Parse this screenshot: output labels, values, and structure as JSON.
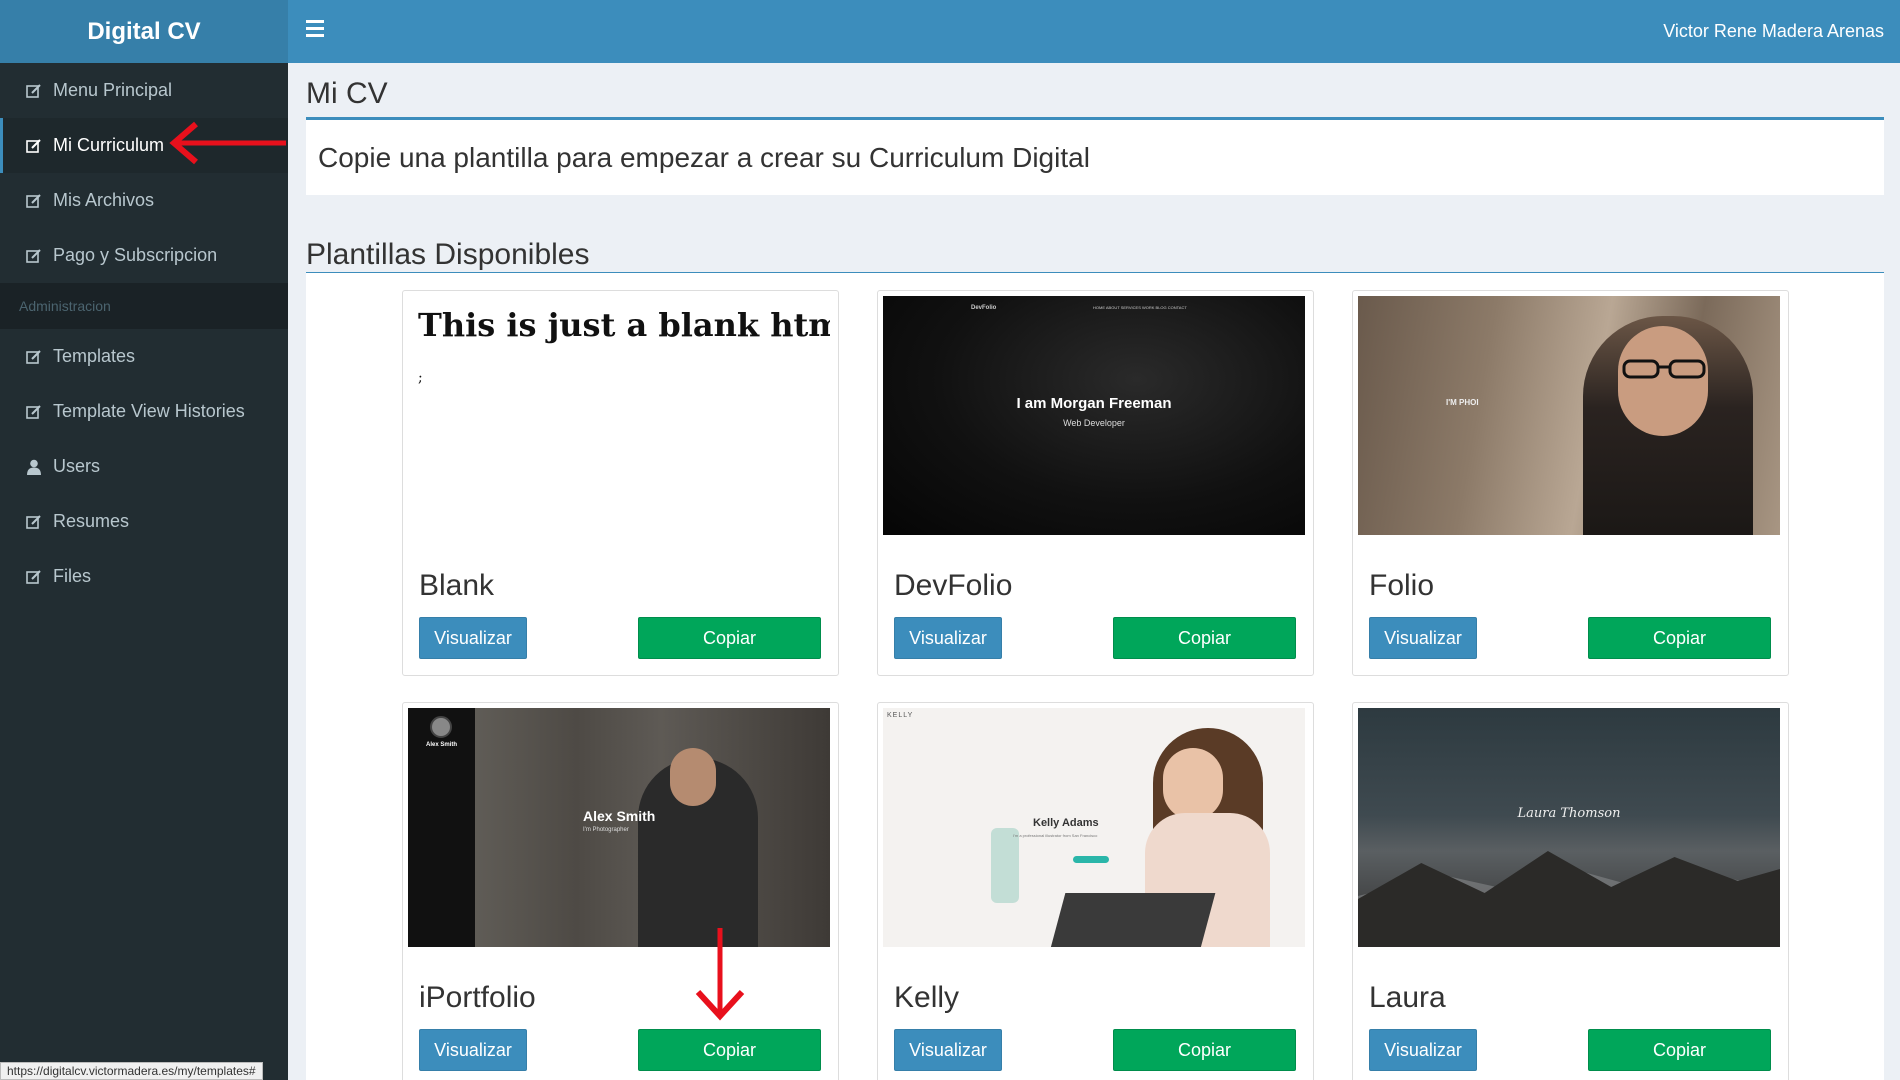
{
  "brand": "Digital CV",
  "header": {
    "username": "Victor Rene Madera Arenas"
  },
  "sidebar": {
    "items": [
      {
        "label": "Menu Principal"
      },
      {
        "label": "Mi Curriculum"
      },
      {
        "label": "Mis Archivos"
      },
      {
        "label": "Pago y Subscripcion"
      }
    ],
    "admin_header": "Administracion",
    "admin_items": [
      {
        "label": "Templates"
      },
      {
        "label": "Template View Histories"
      },
      {
        "label": "Users"
      },
      {
        "label": "Resumes"
      },
      {
        "label": "Files"
      }
    ]
  },
  "main": {
    "title": "Mi CV",
    "intro": "Copie una plantilla para empezar a crear su Curriculum Digital",
    "templates_title": "Plantillas Disponibles",
    "templates": [
      {
        "name": "Blank",
        "view_label": "Visualizar",
        "copy_label": "Copiar",
        "preview_heading": "This is just a blank html",
        "preview_text": ";"
      },
      {
        "name": "DevFolio",
        "view_label": "Visualizar",
        "copy_label": "Copiar",
        "preview_brand": "DevFolio",
        "preview_nav": "HOME   ABOUT   SERVICES   WORK   BLOG   CONTACT",
        "preview_title": "I am Morgan Freeman",
        "preview_subtitle": "Web Developer"
      },
      {
        "name": "Folio",
        "view_label": "Visualizar",
        "copy_label": "Copiar",
        "preview_title": "I'M PHOI"
      },
      {
        "name": "iPortfolio",
        "view_label": "Visualizar",
        "copy_label": "Copiar",
        "preview_sidebar_name": "Alex Smith",
        "preview_title": "Alex Smith",
        "preview_subtitle": "I'm Photographer"
      },
      {
        "name": "Kelly",
        "view_label": "Visualizar",
        "copy_label": "Copiar",
        "preview_brand": "KELLY",
        "preview_title": "Kelly Adams",
        "preview_subtitle": "I'm a professional illustrator from San Francisco"
      },
      {
        "name": "Laura",
        "view_label": "Visualizar",
        "copy_label": "Copiar",
        "preview_title": "Laura Thomson"
      }
    ]
  },
  "statusbar": {
    "url": "https://digitalcv.victormadera.es/my/templates#"
  },
  "colors": {
    "header": "#3c8dbc",
    "brand": "#367fa9",
    "sidebar": "#222d32",
    "primary": "#3c8dbc",
    "success": "#00a65a",
    "annotation": "#e8101c"
  }
}
